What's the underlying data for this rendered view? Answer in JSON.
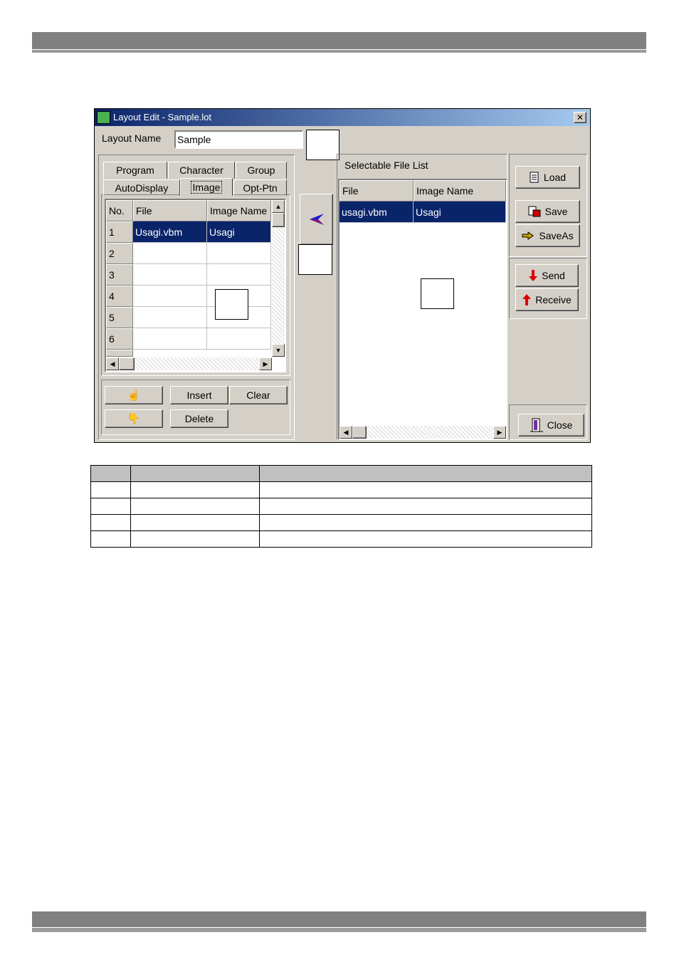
{
  "window": {
    "title": "Layout Edit - Sample.lot",
    "close_glyph": "✕"
  },
  "layout_name": {
    "label": "Layout Name",
    "value": "Sample"
  },
  "tabs": {
    "row1": [
      "Program",
      "Character",
      "Group"
    ],
    "row2": [
      "AutoDisplay",
      "Image",
      "Opt-Ptn"
    ],
    "active": "Image"
  },
  "left_table": {
    "headers": [
      "No.",
      "File",
      "Image Name"
    ],
    "rows": [
      {
        "no": "1",
        "file": "Usagi.vbm",
        "name": "Usagi"
      },
      {
        "no": "2",
        "file": "",
        "name": ""
      },
      {
        "no": "3",
        "file": "",
        "name": ""
      },
      {
        "no": "4",
        "file": "",
        "name": ""
      },
      {
        "no": "5",
        "file": "",
        "name": ""
      },
      {
        "no": "6",
        "file": "",
        "name": ""
      }
    ]
  },
  "edit_buttons": {
    "insert": "Insert",
    "clear": "Clear",
    "delete": "Delete",
    "up_icon": "hand-up-icon",
    "down_icon": "hand-down-icon"
  },
  "transfer": {
    "icon": "arrow-left-icon",
    "glyph": "➤"
  },
  "file_list": {
    "title": "Selectable File List",
    "headers": [
      "File",
      "Image Name"
    ],
    "rows": [
      {
        "file": "usagi.vbm",
        "name": "Usagi"
      }
    ]
  },
  "side_buttons": {
    "load": "Load",
    "save": "Save",
    "saveas": "SaveAs",
    "send": "Send",
    "receive": "Receive",
    "close": "Close"
  },
  "colors": {
    "selection": "#0a246a",
    "face": "#d4d0c8",
    "header_bar": "#808080"
  }
}
